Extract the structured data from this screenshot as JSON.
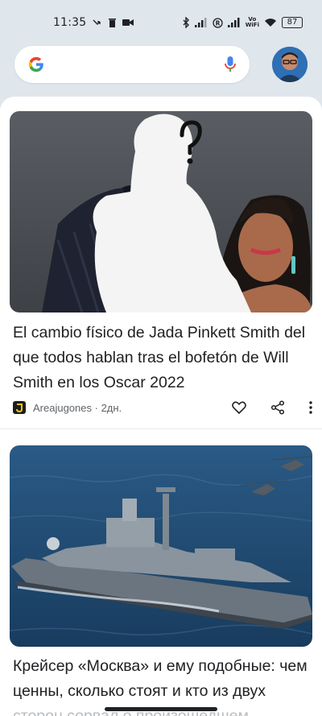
{
  "status_bar": {
    "time": "11:35",
    "battery": "87"
  },
  "search": {
    "placeholder": ""
  },
  "cards": [
    {
      "title": "El cambio físico de Jada Pinkett Smith del que todos hablan tras el bofetón de Will Smith en los Oscar 2022",
      "source": "Areajugones",
      "time_ago": "2дн."
    },
    {
      "title_line1": "Крейсер «Москва» и ему подобные: чем ценны, сколько стоят и кто из двух",
      "title_line2": "сторон сорвал о произошедшем"
    }
  ],
  "colors": {
    "background": "#dfe6ec",
    "card": "#ffffff",
    "text": "#202124",
    "meta": "#5f6368"
  }
}
